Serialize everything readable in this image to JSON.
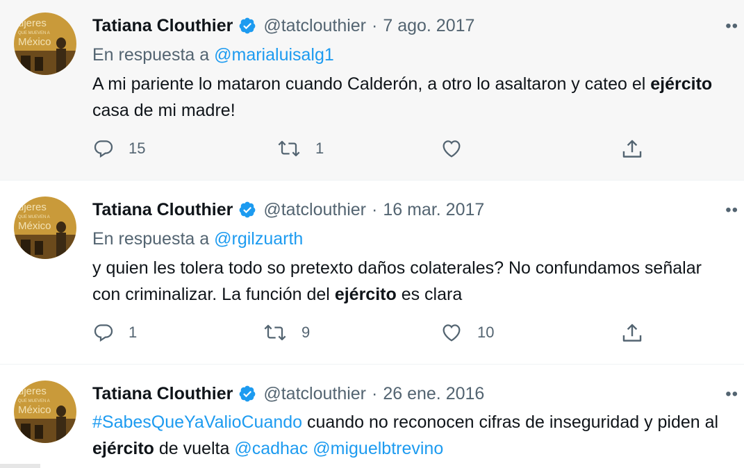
{
  "colors": {
    "link": "#1d9bf0",
    "secondary_text": "#536471",
    "verified_badge": "#1d9bf0",
    "highlight_background": "#f7f7f7"
  },
  "tweets": [
    {
      "author_name": "Tatiana Clouthier",
      "handle": "@tatclouthier",
      "separator": "·",
      "date": "7 ago. 2017",
      "reply_prefix": "En respuesta a",
      "reply_to": "@marialuisalg1",
      "text_before": "A mi pariente lo mataron cuando Calderón, a otro lo asaltaron y cateo el",
      "text_bold": "ejército",
      "text_after": "casa de mi madre!",
      "replies": "15",
      "retweets": "1",
      "likes": "",
      "avatar_text": [
        "ujeres",
        "QUE MUEVEN A",
        "México"
      ]
    },
    {
      "author_name": "Tatiana Clouthier",
      "handle": "@tatclouthier",
      "separator": "·",
      "date": "16 mar. 2017",
      "reply_prefix": "En respuesta a",
      "reply_to": "@rgilzuarth",
      "text_before": "y quien les tolera todo so pretexto daños colaterales? No confundamos señalar con criminalizar. La función del",
      "text_bold": "ejército",
      "text_after": "es clara",
      "replies": "1",
      "retweets": "9",
      "likes": "10",
      "avatar_text": [
        "ujeres",
        "QUE MUEVEN A",
        "México"
      ]
    },
    {
      "author_name": "Tatiana Clouthier",
      "handle": "@tatclouthier",
      "separator": "·",
      "date": "26 ene. 2016",
      "hashtag": "#SabesQueYaValioCuando",
      "text_before": "cuando no reconocen cifras de inseguridad y piden al",
      "text_bold": "ejército",
      "text_after": "de vuelta",
      "mention1": "@cadhac",
      "mention2": "@miguelbtrevino",
      "avatar_text": [
        "ujeres",
        "QUE MUEVEN A",
        "México"
      ]
    }
  ],
  "icons": {
    "more": "more-horizontal-icon",
    "verified": "verified-badge-icon",
    "reply": "reply-icon",
    "retweet": "retweet-icon",
    "like": "heart-icon",
    "share": "share-icon"
  }
}
